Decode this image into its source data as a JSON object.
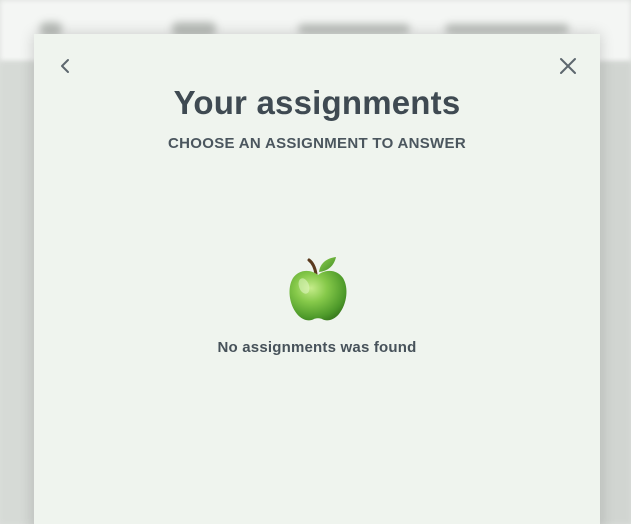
{
  "modal": {
    "title": "Your assignments",
    "subtitle": "CHOOSE AN ASSIGNMENT TO ANSWER",
    "back_icon": "chevron-left-icon",
    "close_icon": "close-icon"
  },
  "empty_state": {
    "icon": "green-apple-icon",
    "message": "No assignments was found"
  },
  "colors": {
    "modal_background": "#eff4ee",
    "title_text": "#3f4a52",
    "apple_green": "#7cc443"
  }
}
